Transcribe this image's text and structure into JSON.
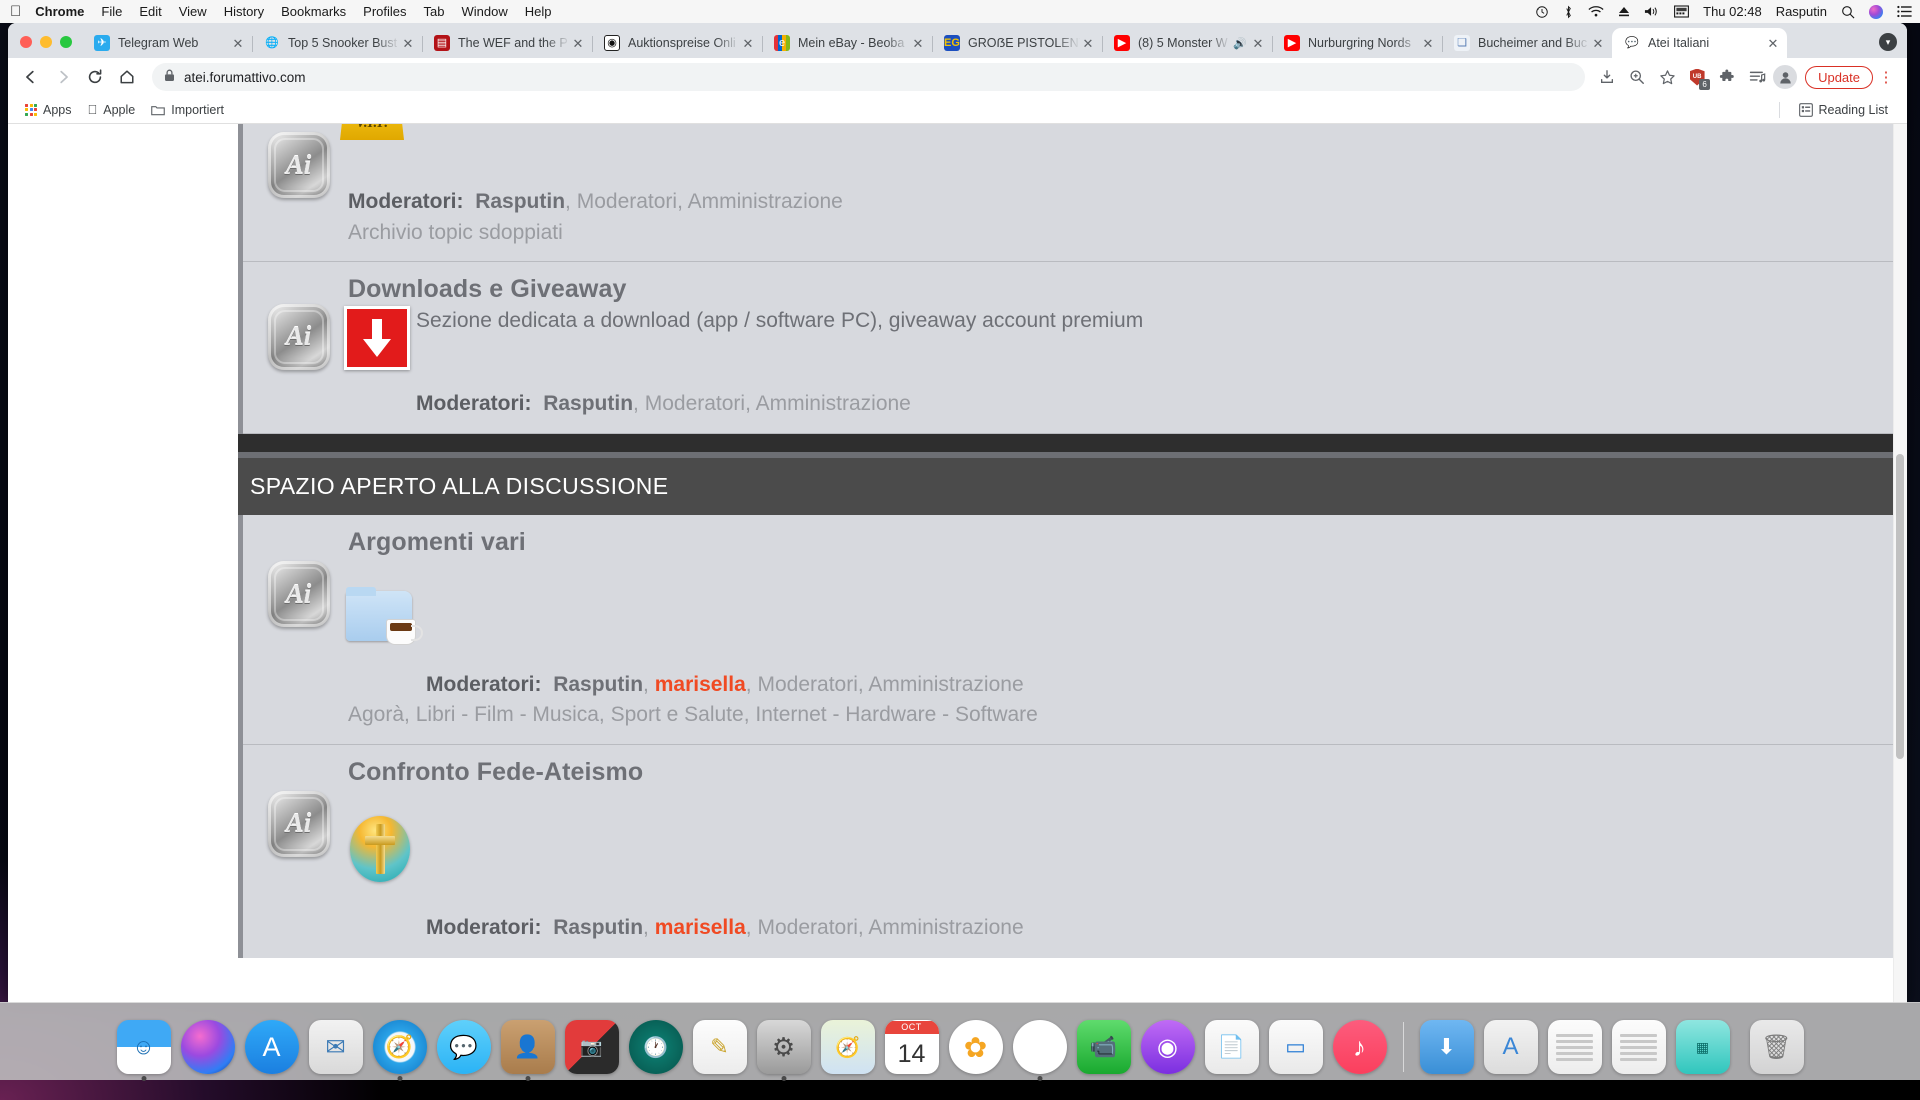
{
  "menubar": {
    "apple": "apple-logo",
    "items": [
      "Chrome",
      "File",
      "Edit",
      "View",
      "History",
      "Bookmarks",
      "Profiles",
      "Tab",
      "Window",
      "Help"
    ],
    "status": {
      "time_machine": "⟲",
      "bluetooth": "✳",
      "wifi": "wifi",
      "eject": "⏏",
      "volume": "🔊",
      "input_source": "⌨",
      "clock": "Thu 02:48",
      "user": "Rasputin",
      "search": "⌕",
      "siri": "siri",
      "control_center": "☰"
    }
  },
  "browser": {
    "tabs": [
      {
        "title": "Telegram Web",
        "favicon": "telegram-icon",
        "glyph": "✈",
        "class": "fi-telegram",
        "active": false,
        "audio": false
      },
      {
        "title": "Top 5 Snooker Bust",
        "favicon": "globe-icon",
        "glyph": "🌐",
        "class": "fi-globe",
        "active": false,
        "audio": false
      },
      {
        "title": "The WEF and the P",
        "favicon": "document-icon",
        "glyph": "▤",
        "class": "fi-wef",
        "active": false,
        "audio": false
      },
      {
        "title": "Auktionspreise Onli",
        "favicon": "target-icon",
        "glyph": "◉",
        "class": "fi-auk",
        "active": false,
        "audio": false
      },
      {
        "title": "Mein eBay - Beoba",
        "favicon": "ebay-icon",
        "glyph": "e",
        "class": "fi-ebay",
        "active": false,
        "audio": false
      },
      {
        "title": "GROẞE PISTOLENT",
        "favicon": "eg-icon",
        "glyph": "EG",
        "class": "fi-pistol",
        "active": false,
        "audio": false
      },
      {
        "title": "(8) 5 Monster W",
        "favicon": "youtube-icon",
        "glyph": "▶",
        "class": "fi-yt",
        "active": false,
        "audio": true
      },
      {
        "title": "Nurburgring Nords",
        "favicon": "youtube-icon",
        "glyph": "▶",
        "class": "fi-yt",
        "active": false,
        "audio": false
      },
      {
        "title": "Bucheimer and Buc",
        "favicon": "page-icon",
        "glyph": "❏",
        "class": "fi-buch",
        "active": false,
        "audio": false
      },
      {
        "title": "Atei Italiani",
        "favicon": "chat-bubble-icon",
        "glyph": "💬",
        "class": "fi-atei",
        "active": true,
        "audio": false
      }
    ],
    "new_tab_label": "+",
    "tab_search_label": "▾",
    "toolbar": {
      "back": "←",
      "forward": "→",
      "reload": "⟳",
      "home": "⌂",
      "url": "atei.forumattivo.com",
      "lock": "🔒",
      "download": "⤓",
      "zoom": "⊕",
      "bookmark_star": "☆",
      "adblock_label": "UB",
      "adblock_count": "6",
      "extensions": "🧩",
      "reading_list": "≡♪",
      "profile": "👤",
      "update_label": "Update",
      "menu": "⋮"
    },
    "bookmarks": [
      {
        "label": "Apps",
        "icon": "apps-grid-icon"
      },
      {
        "label": "Apple",
        "icon": "apple-icon"
      },
      {
        "label": "Importiert",
        "icon": "folder-icon"
      }
    ],
    "reading_list_label": "Reading List",
    "reading_list_icon": "reading-list-icon"
  },
  "page": {
    "rows_top": [
      {
        "id": "vip-archive",
        "title": "",
        "emblem": "vip-sign-icon",
        "emblem_text": "V.I.P.",
        "mods_label": "Moderatori:",
        "mods": [
          {
            "text": "Rasputin",
            "style": "strong"
          },
          {
            "text": "Moderatori",
            "style": "normal"
          },
          {
            "text": "Amministrazione",
            "style": "normal"
          }
        ],
        "sublinks": [
          "Archivio topic sdoppiati"
        ]
      },
      {
        "id": "downloads-giveaway",
        "title": "Downloads e Giveaway",
        "emblem": "download-arrow-icon",
        "description": "Sezione dedicata a download (app / software PC), giveaway account premium",
        "mods_label": "Moderatori:",
        "mods": [
          {
            "text": "Rasputin",
            "style": "strong"
          },
          {
            "text": "Moderatori",
            "style": "normal"
          },
          {
            "text": "Amministrazione",
            "style": "normal"
          }
        ],
        "sublinks": []
      }
    ],
    "category": {
      "title": "SPAZIO APERTO ALLA DISCUSSIONE",
      "rows": [
        {
          "id": "argomenti-vari",
          "title": "Argomenti vari",
          "emblem": "folder-coffee-icon",
          "description": "",
          "mods_label": "Moderatori:",
          "mods": [
            {
              "text": "Rasputin",
              "style": "strong"
            },
            {
              "text": "marisella",
              "style": "red"
            },
            {
              "text": "Moderatori",
              "style": "normal"
            },
            {
              "text": "Amministrazione",
              "style": "normal"
            }
          ],
          "sublinks": [
            "Agorà",
            "Libri - Film - Musica",
            "Sport e Salute",
            "Internet - Hardware - Software"
          ]
        },
        {
          "id": "confronto-fede-ateismo",
          "title": "Confronto Fede-Ateismo",
          "emblem": "cross-icon",
          "description": "",
          "mods_label": "Moderatori:",
          "mods": [
            {
              "text": "Rasputin",
              "style": "strong"
            },
            {
              "text": "marisella",
              "style": "red"
            },
            {
              "text": "Moderatori",
              "style": "normal"
            },
            {
              "text": "Amministrazione",
              "style": "normal"
            }
          ],
          "sublinks": []
        }
      ]
    }
  },
  "dock": {
    "items": [
      {
        "name": "finder",
        "glyph": "☺",
        "class": "d-finder",
        "running": true
      },
      {
        "name": "siri",
        "glyph": "",
        "class": "d-siri",
        "running": false
      },
      {
        "name": "app-store",
        "glyph": "A",
        "class": "d-appstore",
        "running": false
      },
      {
        "name": "mail",
        "glyph": "✉",
        "class": "d-mail",
        "running": false
      },
      {
        "name": "safari",
        "glyph": "🧭",
        "class": "d-safari",
        "running": true
      },
      {
        "name": "messages",
        "glyph": "💬",
        "class": "d-messages",
        "running": false
      },
      {
        "name": "contacts",
        "glyph": "👤",
        "class": "d-contacts",
        "running": true
      },
      {
        "name": "photo-booth",
        "glyph": "📷",
        "class": "d-photobooth",
        "running": false
      },
      {
        "name": "time-machine",
        "glyph": "🕐",
        "class": "d-timemachine",
        "running": false
      },
      {
        "name": "notes",
        "glyph": "✎",
        "class": "d-notes",
        "running": false
      },
      {
        "name": "system-preferences",
        "glyph": "⚙",
        "class": "d-settings",
        "running": true
      },
      {
        "name": "maps",
        "glyph": "🧭",
        "class": "d-maps",
        "running": false
      },
      {
        "name": "calendar",
        "glyph": "14",
        "class": "d-calendar",
        "running": false,
        "month": "OCT"
      },
      {
        "name": "photos",
        "glyph": "✿",
        "class": "d-photos",
        "running": false
      },
      {
        "name": "chrome",
        "glyph": "◉",
        "class": "d-chrome",
        "running": true
      },
      {
        "name": "facetime",
        "glyph": "📹",
        "class": "d-facetime",
        "running": false
      },
      {
        "name": "podcasts",
        "glyph": "◉",
        "class": "d-podcasts",
        "running": false
      },
      {
        "name": "pages",
        "glyph": "📄",
        "class": "d-pages",
        "running": false
      },
      {
        "name": "keynote",
        "glyph": "▭",
        "class": "d-keynote",
        "running": false
      },
      {
        "name": "music",
        "glyph": "♪",
        "class": "d-music",
        "running": false
      }
    ],
    "stacks": [
      {
        "name": "downloads-stack",
        "glyph": "⬇",
        "class": "d-downloads"
      },
      {
        "name": "applications-stack",
        "glyph": "A",
        "class": "d-appstore2"
      },
      {
        "name": "documents-stack",
        "glyph": "",
        "class": "d-stack1"
      },
      {
        "name": "recent-stack",
        "glyph": "",
        "class": "d-stack2"
      },
      {
        "name": "screenshots-stack",
        "glyph": "▦",
        "class": "d-stack3"
      }
    ],
    "trash": {
      "name": "trash",
      "glyph": "🗑",
      "class": "d-trash"
    }
  }
}
